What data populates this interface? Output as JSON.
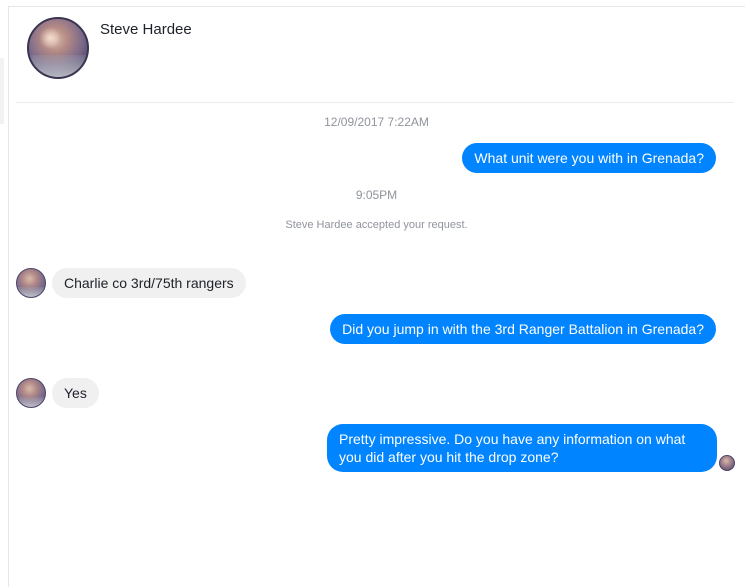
{
  "conversation": {
    "contact_name": "Steve Hardee",
    "messages": [
      {
        "type": "timestamp",
        "text": "12/09/2017 7:22AM"
      },
      {
        "type": "outgoing",
        "text": "What unit were you with in Grenada?"
      },
      {
        "type": "timestamp",
        "text": "9:05PM"
      },
      {
        "type": "system",
        "text": "Steve Hardee accepted your request."
      },
      {
        "type": "incoming",
        "text": "Charlie co 3rd/75th rangers"
      },
      {
        "type": "outgoing",
        "text": "Did you jump in with the 3rd Ranger Battalion in Grenada?"
      },
      {
        "type": "incoming",
        "text": "Yes"
      },
      {
        "type": "outgoing",
        "text": "Pretty impressive.  Do you have any information on what you did after you hit the drop zone?"
      }
    ]
  },
  "colors": {
    "outgoing_bubble": "#0084ff",
    "incoming_bubble": "#f1f0f0",
    "meta_text": "#90949c"
  }
}
